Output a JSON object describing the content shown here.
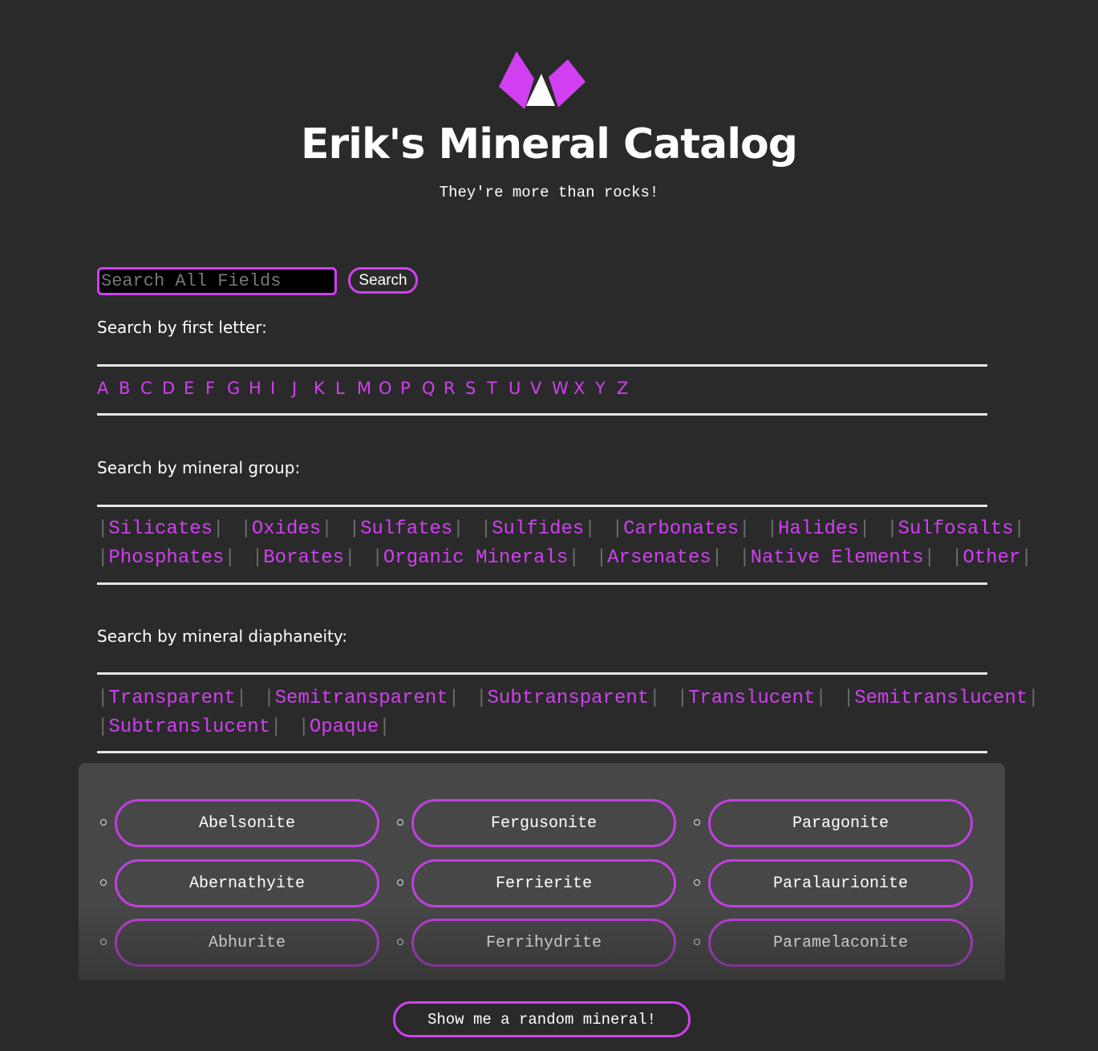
{
  "header": {
    "logo_icon": "crystal-logo-icon",
    "title": "Erik's Mineral Catalog",
    "tagline": "They're more than rocks!"
  },
  "search": {
    "placeholder": "Search All Fields",
    "value": "",
    "button_label": "Search"
  },
  "letter_section": {
    "label": "Search by first letter:",
    "letters": [
      "A",
      "B",
      "C",
      "D",
      "E",
      "F",
      "G",
      "H",
      "I",
      "J",
      "K",
      "L",
      "M",
      "O",
      "P",
      "Q",
      "R",
      "S",
      "T",
      "U",
      "V",
      "W",
      "X",
      "Y",
      "Z"
    ]
  },
  "group_section": {
    "label": "Search by mineral group:",
    "rows": [
      [
        "Silicates",
        "Oxides",
        "Sulfates",
        "Sulfides",
        "Carbonates",
        "Halides",
        "Sulfosalts"
      ],
      [
        "Phosphates",
        "Borates",
        "Organic Minerals",
        "Arsenates",
        "Native Elements",
        "Other"
      ]
    ]
  },
  "diaphaneity_section": {
    "label": "Search by mineral diaphaneity:",
    "rows": [
      [
        "Transparent",
        "Semitransparent",
        "Subtransparent",
        "Translucent",
        "Semitranslucent"
      ],
      [
        "Subtranslucent",
        "Opaque"
      ]
    ]
  },
  "minerals": {
    "columns": [
      [
        "Abelsonite",
        "Abernathyite",
        "Abhurite"
      ],
      [
        "Fergusonite",
        "Ferrierite",
        "Ferrihydrite"
      ],
      [
        "Paragonite",
        "Paralaurionite",
        "Paramelaconite"
      ]
    ]
  },
  "footer": {
    "random_button_label": "Show me a random mineral!"
  },
  "colors": {
    "accent": "#d040f0",
    "background": "#2a2a2a",
    "panel": "#474747",
    "pipe": "#6b6b6b"
  }
}
